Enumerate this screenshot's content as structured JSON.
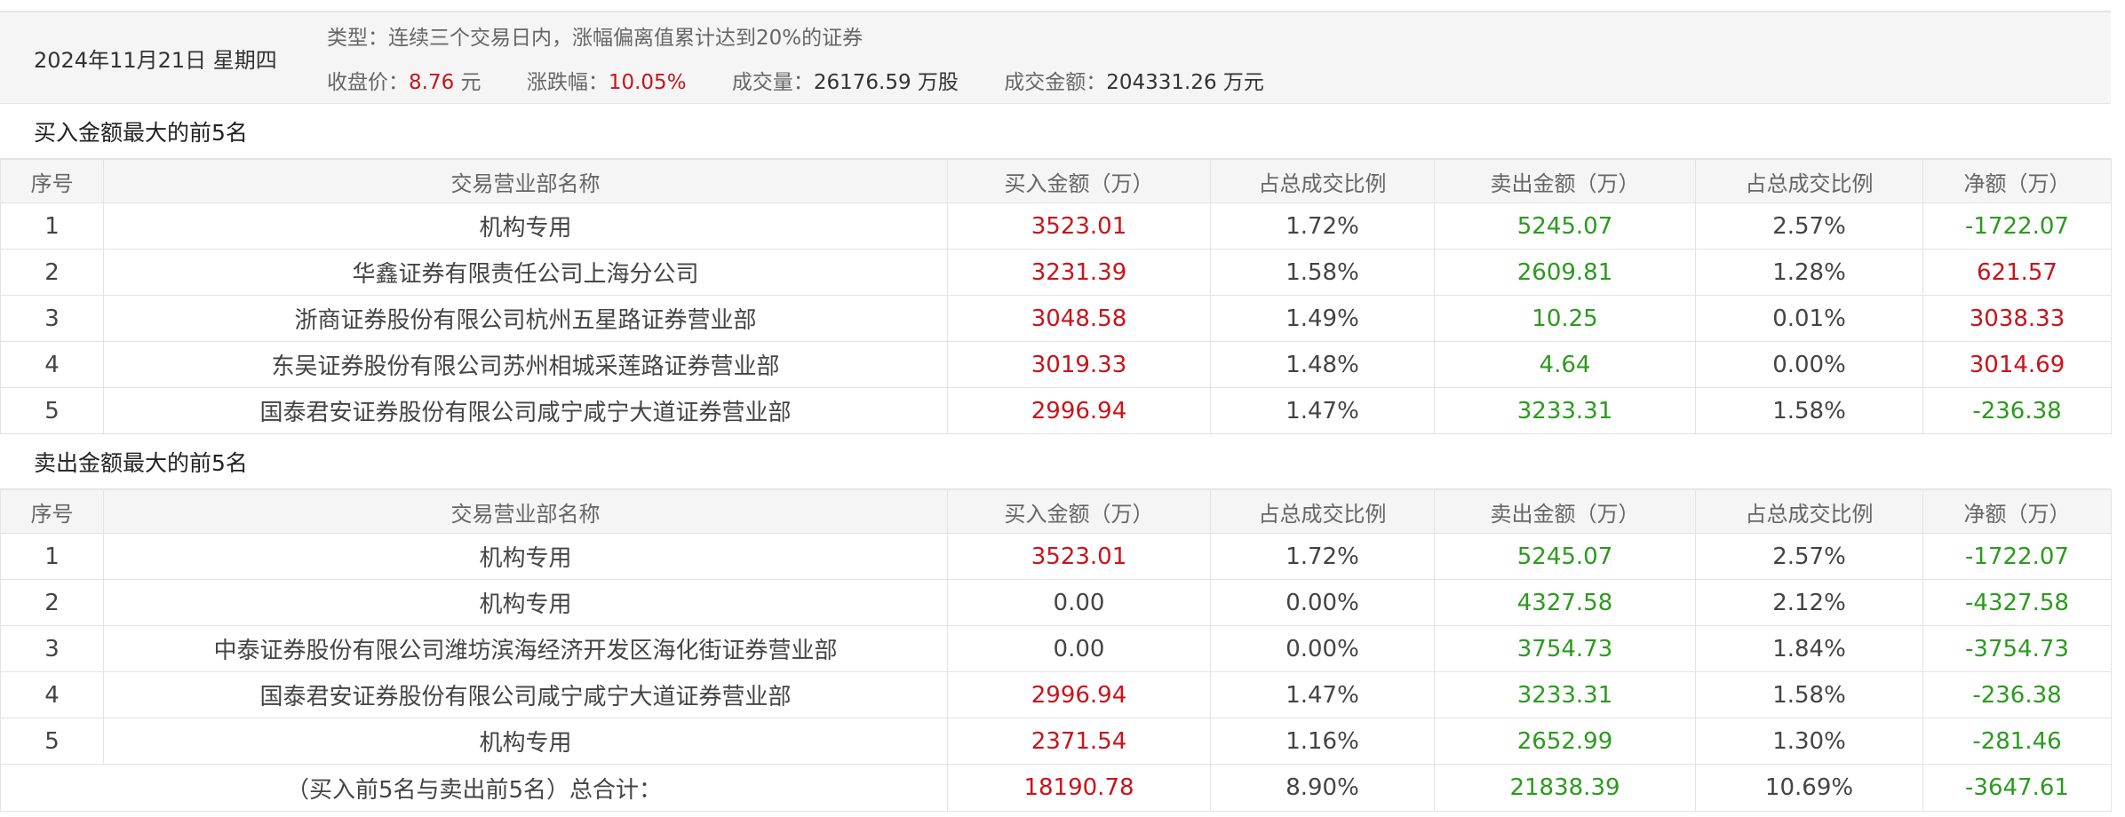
{
  "header": {
    "date": "2024年11月21日 星期四",
    "type_label": "类型：",
    "type_value": "连续三个交易日内，涨幅偏离值累计达到20%的证券",
    "close_label": "收盘价：",
    "close_value": "8.76",
    "close_unit": "元",
    "change_label": "涨跌幅：",
    "change_value": "10.05%",
    "volume_label": "成交量：",
    "volume_value": "26176.59 万股",
    "amount_label": "成交金额：",
    "amount_value": "204331.26 万元"
  },
  "columns": [
    "序号",
    "交易营业部名称",
    "买入金额（万）",
    "占总成交比例",
    "卖出金额（万）",
    "占总成交比例",
    "净额（万）"
  ],
  "buy_section": {
    "title": "买入金额最大的前5名",
    "rows": [
      {
        "no": "1",
        "name": "机构专用",
        "buy": "3523.01",
        "buy_pct": "1.72%",
        "sell": "5245.07",
        "sell_pct": "2.57%",
        "net": "-1722.07",
        "buy_color": "red",
        "net_color": "green"
      },
      {
        "no": "2",
        "name": "华鑫证券有限责任公司上海分公司",
        "buy": "3231.39",
        "buy_pct": "1.58%",
        "sell": "2609.81",
        "sell_pct": "1.28%",
        "net": "621.57",
        "buy_color": "red",
        "net_color": "red"
      },
      {
        "no": "3",
        "name": "浙商证券股份有限公司杭州五星路证券营业部",
        "buy": "3048.58",
        "buy_pct": "1.49%",
        "sell": "10.25",
        "sell_pct": "0.01%",
        "net": "3038.33",
        "buy_color": "red",
        "net_color": "red"
      },
      {
        "no": "4",
        "name": "东吴证券股份有限公司苏州相城采莲路证券营业部",
        "buy": "3019.33",
        "buy_pct": "1.48%",
        "sell": "4.64",
        "sell_pct": "0.00%",
        "net": "3014.69",
        "buy_color": "red",
        "net_color": "red"
      },
      {
        "no": "5",
        "name": "国泰君安证券股份有限公司咸宁咸宁大道证券营业部",
        "buy": "2996.94",
        "buy_pct": "1.47%",
        "sell": "3233.31",
        "sell_pct": "1.58%",
        "net": "-236.38",
        "buy_color": "red",
        "net_color": "green"
      }
    ]
  },
  "sell_section": {
    "title": "卖出金额最大的前5名",
    "rows": [
      {
        "no": "1",
        "name": "机构专用",
        "buy": "3523.01",
        "buy_pct": "1.72%",
        "sell": "5245.07",
        "sell_pct": "2.57%",
        "net": "-1722.07",
        "buy_color": "red",
        "net_color": "green"
      },
      {
        "no": "2",
        "name": "机构专用",
        "buy": "0.00",
        "buy_pct": "0.00%",
        "sell": "4327.58",
        "sell_pct": "2.12%",
        "net": "-4327.58",
        "buy_color": "plain",
        "net_color": "green"
      },
      {
        "no": "3",
        "name": "中泰证券股份有限公司潍坊滨海经济开发区海化街证券营业部",
        "buy": "0.00",
        "buy_pct": "0.00%",
        "sell": "3754.73",
        "sell_pct": "1.84%",
        "net": "-3754.73",
        "buy_color": "plain",
        "net_color": "green"
      },
      {
        "no": "4",
        "name": "国泰君安证券股份有限公司咸宁咸宁大道证券营业部",
        "buy": "2996.94",
        "buy_pct": "1.47%",
        "sell": "3233.31",
        "sell_pct": "1.58%",
        "net": "-236.38",
        "buy_color": "red",
        "net_color": "green"
      },
      {
        "no": "5",
        "name": "机构专用",
        "buy": "2371.54",
        "buy_pct": "1.16%",
        "sell": "2652.99",
        "sell_pct": "1.30%",
        "net": "-281.46",
        "buy_color": "red",
        "net_color": "green"
      }
    ]
  },
  "total": {
    "label": "（买入前5名与卖出前5名）总合计：",
    "buy": "18190.78",
    "buy_pct": "8.90%",
    "sell": "21838.39",
    "sell_pct": "10.69%",
    "net": "-3647.61"
  },
  "colors": {
    "red": "#c9141b",
    "green": "#2c9a1f",
    "header_bg": "#f5f5f5",
    "border": "#e4e4e4"
  }
}
